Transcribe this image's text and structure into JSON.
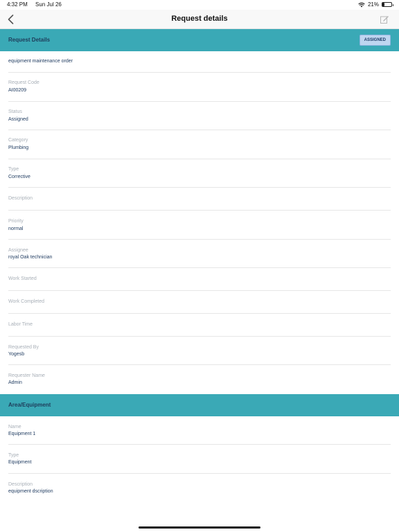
{
  "status_bar": {
    "time": "4:32 PM",
    "date": "Sun Jul 26",
    "battery": "21%",
    "battery_level": 0.21
  },
  "nav": {
    "title": "Request details"
  },
  "request_section": {
    "title": "Request Details",
    "badge": "ASSIGNED"
  },
  "request_fields": [
    {
      "label": "",
      "value": "equipment maintenance order"
    },
    {
      "label": "Request Code",
      "value": "AI00209"
    },
    {
      "label": "Status",
      "value": "Assigned"
    },
    {
      "label": "Category",
      "value": "Plumbing"
    },
    {
      "label": "Type",
      "value": "Corrective"
    },
    {
      "label": "Description",
      "value": ""
    },
    {
      "label": "Priority",
      "value": "normal"
    },
    {
      "label": "Assignee",
      "value": "royal Oak technician"
    },
    {
      "label": "Work Started",
      "value": ""
    },
    {
      "label": "Work Completed",
      "value": ""
    },
    {
      "label": "Labor Time",
      "value": ""
    },
    {
      "label": "Requested By",
      "value": "Yogesb"
    },
    {
      "label": "Requester Name",
      "value": "Admin"
    }
  ],
  "area_section": {
    "title": "Area/Equipment"
  },
  "area_fields": [
    {
      "label": "Name",
      "value": "Equipment 1"
    },
    {
      "label": "Type",
      "value": "Equipment"
    },
    {
      "label": "Description",
      "value": "equipment dscription"
    }
  ]
}
